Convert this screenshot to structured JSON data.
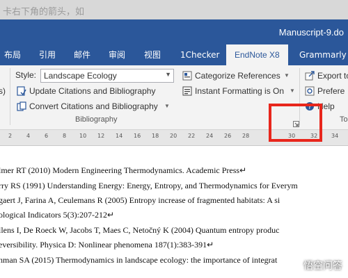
{
  "browser_bar": {
    "faded_text": "卡右下角的箭头，如"
  },
  "window": {
    "title": "Manuscript-9.do"
  },
  "tabs": [
    {
      "label": "布局"
    },
    {
      "label": "引用"
    },
    {
      "label": "邮件"
    },
    {
      "label": "审阅"
    },
    {
      "label": "视图"
    },
    {
      "label": "1Checker"
    },
    {
      "label": "EndNote X8"
    },
    {
      "label": "Grammarly"
    }
  ],
  "ribbon": {
    "style_label": "Style:",
    "style_value": "Landscape Ecology",
    "update_citations": "Update Citations and Bibliography",
    "convert_citations": "Convert Citations and Bibliography",
    "categorize_references": "Categorize References",
    "instant_formatting": "Instant Formatting is On",
    "export_to": "Export to",
    "preferences": "Prefere",
    "help": "Help",
    "bibliography_group": "Bibliography",
    "next_group": "To",
    "left_cut": "s)"
  },
  "ruler": [
    "2",
    "4",
    "6",
    "8",
    "10",
    "12",
    "14",
    "16",
    "18",
    "20",
    "22",
    "24",
    "26",
    "28",
    "30",
    "32",
    "34"
  ],
  "document": {
    "lines": [
      "lmer RT (2010) Modern Engineering Thermodynamics. Academic Press↵",
      "rry RS (1991) Understanding Energy: Energy, Entropy, and Thermodynamics for Everym",
      "gaert J, Farina A, Ceulemans R (2005) Entropy increase of fragmented habitats: A si",
      "ological Indicators 5(3):207-212↵",
      "llens I, De Roeck W, Jacobs T, Maes C, Netočný K (2004) Quantum entropy produc",
      "eversibility. Physica D: Nonlinear phenomena 187(1):383-391↵",
      "hman SA (2015) Thermodynamics in landscape ecology: the importance of integrat"
    ]
  },
  "watermark": {
    "text": "悟空问答"
  },
  "colors": {
    "word_blue": "#2b579a",
    "highlight": "#e8261c"
  }
}
